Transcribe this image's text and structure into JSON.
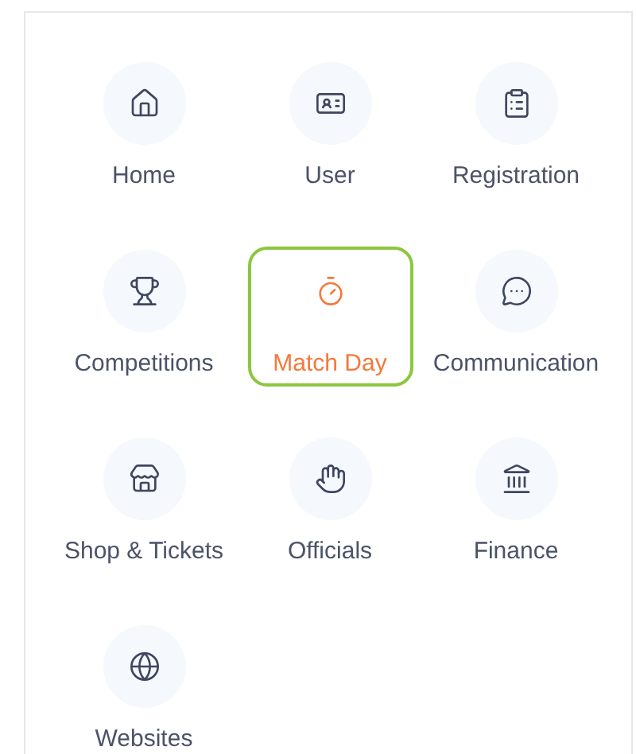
{
  "menu": {
    "items": [
      {
        "label": "Home",
        "selected": false
      },
      {
        "label": "User",
        "selected": false
      },
      {
        "label": "Registration",
        "selected": false
      },
      {
        "label": "Competitions",
        "selected": false
      },
      {
        "label": "Match Day",
        "selected": true
      },
      {
        "label": "Communication",
        "selected": false
      },
      {
        "label": "Shop & Tickets",
        "selected": false
      },
      {
        "label": "Officials",
        "selected": false
      },
      {
        "label": "Finance",
        "selected": false
      },
      {
        "label": "Websites",
        "selected": false
      }
    ]
  }
}
